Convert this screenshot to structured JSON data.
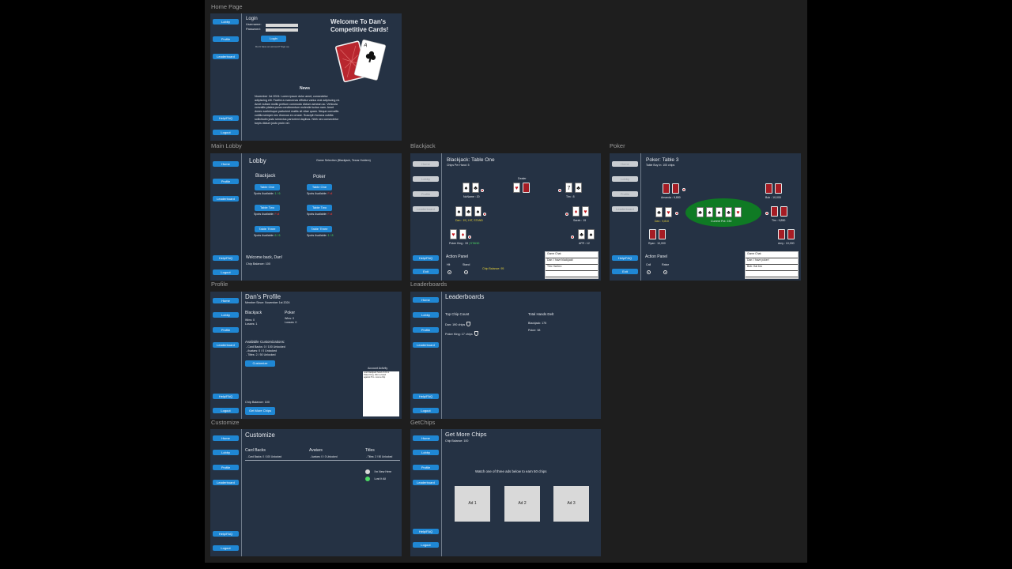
{
  "frames": {
    "home": "Home Page",
    "lobby": "Main Lobby",
    "blackjack": "Blackjack",
    "poker": "Poker",
    "profile": "Profile",
    "leaderboard": "Leaderboards",
    "customize": "Customize",
    "getchips": "GetChips"
  },
  "nav": {
    "home": "Home",
    "lobby": "Lobby",
    "profile": "Profile",
    "leaderboard": "Leaderboard",
    "help": "Help/FAQ",
    "logout": "Logout",
    "exit": "Exit"
  },
  "home": {
    "login_title": "Login",
    "username_label": "Username:",
    "password_label": "Password:",
    "login_button": "Login",
    "signup_text": "Don't have an account? Sign up",
    "welcome_line1": "Welcome To Dan's",
    "welcome_line2": "Competitive Cards!",
    "news_title": "News",
    "news_body": [
      "November 1st 2024: Lorem ipsum dolor amet, consectetur",
      "adipiscing elit. Facilisi a maecenas efficitur varius erat adipiscing mi.",
      "Amet nullam mollis pretium commodo dictum aenean ac. Vehicula",
      "convallis platea purus condimentum molestie luctus nam. Amet",
      "donec scelerisque parturient mattis sit vitae quam. Neque convallis",
      "cubilia semper nec rhoncus ex ornare. Suscipit rhoncus cubilia",
      "sollicitudin justo senectus parturient dapibus. Nibh nec consectetur",
      "turpis dictum justo proin vel."
    ]
  },
  "lobby": {
    "title": "Lobby",
    "game_selection": "Game Selection (Blackjack, Texas Holdem)",
    "blackjack_heading": "Blackjack",
    "poker_heading": "Poker",
    "spots_label": "Spots Available:",
    "blackjack_tables": [
      {
        "name": "Table One",
        "spots": "1 / 6",
        "status": "green"
      },
      {
        "name": "Table Two",
        "spots": "Full",
        "status": "red"
      },
      {
        "name": "Table Three",
        "spots": "6 / 6",
        "status": "green"
      }
    ],
    "poker_tables": [
      {
        "name": "Table One",
        "spots": "Full",
        "status": "red"
      },
      {
        "name": "Table Two",
        "spots": "Full",
        "status": "red"
      },
      {
        "name": "Table Three",
        "spots": "1 / 8",
        "status": "green"
      }
    ],
    "welcome": "Welcome back, Dan!",
    "chip_balance": "Chip Balance: 100"
  },
  "blackjack": {
    "title": "Blackjack: Table One",
    "subtitle": "Chips Per Hand: 5",
    "dealer_label": "Dealer",
    "players": [
      {
        "name": "NoName : 20"
      },
      {
        "name": "Tim : 8"
      },
      {
        "name": "Dan : 19",
        "extra": "| HIT, STAND"
      },
      {
        "name": "Sarah : 15"
      },
      {
        "name": "Poker King : 15",
        "extra": "| STAND"
      },
      {
        "name": "AFR : 12"
      }
    ],
    "action_panel": "Action Panel",
    "hit_label": "Hit",
    "stand_label": "Stand",
    "chip_balance": "Chip Balance: 95",
    "chat_title": "Game Chat:",
    "chat_lines": [
      "Dan: I have blackjack!",
      "Tim: Hai bro",
      "",
      ""
    ]
  },
  "poker": {
    "title": "Poker: Table 3",
    "subtitle": "Table Buy In: 100 chips",
    "players": [
      {
        "name": "Amanda : 9,850"
      },
      {
        "name": "Bob : 10,000"
      },
      {
        "name": "Dan : 9,810"
      },
      {
        "name": "Tim : 9,850"
      },
      {
        "name": "Ryan : 10,000"
      },
      {
        "name": "Amy : 10,000"
      }
    ],
    "pot": "Current Pot: 230",
    "action_panel": "Action Panel",
    "call_label": "Call",
    "raise_label": "Raise",
    "chat_title": "Game Chat:",
    "chat_lines": [
      "Dan: I have poker!",
      "Bob: Hai bro",
      "",
      ""
    ]
  },
  "profile": {
    "title": "Dan's Profile",
    "member_since": "Member Since: November 1st 2024",
    "blackjack_heading": "Blackjack",
    "poker_heading": "Poker",
    "bj_wins": "Wins: 0",
    "bj_losses": "Losses: 1",
    "pk_wins": "Wins: 0",
    "pk_losses": "Losses: 0",
    "custom_heading": "Available Customizations:",
    "custom_lines": [
      "- Card Backs: 0 / 100 Unlocked",
      "- Avatars: 0 / 0 Unlocked",
      "- Titles: 2 / 50 Unlocked"
    ],
    "customize_button": "Customize",
    "activity_title": "Account Activity",
    "activity_lines": [
      "Lost blackjack hand of 24 to",
      "Poker King. Won a hand",
      "against Tim. Lost a chip"
    ],
    "chip_balance": "Chip Balance: 100",
    "get_chips_button": "Get More Chips"
  },
  "leaderboard": {
    "title": "Leaderboards",
    "top_heading": "Top Chip Count",
    "top_entries": [
      "Dan: 190 chips",
      "Poker King: 17 chips"
    ],
    "hands_heading": "Total Hands Delt",
    "hands_entries": [
      "Blackjack: 175",
      "Poker: 38"
    ]
  },
  "customize": {
    "title": "Customize",
    "cols": [
      {
        "heading": "Card Backs",
        "sub": "- Card Backs: 0 / 100 Unlocked"
      },
      {
        "heading": "Avatars",
        "sub": "- Avatars: 0 / 0 Unlocked"
      },
      {
        "heading": "Titles",
        "sub": "- Titles: 2 / 50 Unlocked"
      }
    ],
    "titles_options": [
      {
        "label": "I'm New Here",
        "color": "#d9d9d9"
      },
      {
        "label": "Lost It All",
        "color": "#4cd964"
      }
    ]
  },
  "getchips": {
    "title": "Get More Chips",
    "chip_balance": "Chip Balance: 100",
    "instruction": "Watch one of three ads below to earn 50 chips",
    "ads": [
      "Ad 1",
      "Ad 2",
      "Ad 3"
    ]
  }
}
